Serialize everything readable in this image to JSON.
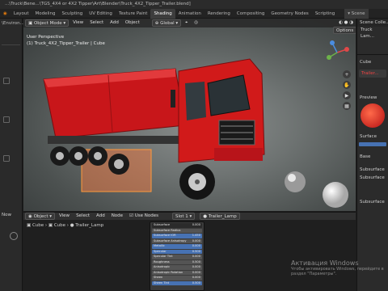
{
  "window": {
    "title": "...\\Truck\\Bene...\\TGS_4X4 or 4X2 Tipper\\Art\\Blender\\Truck_4X2_Tipper_Trailer.blend]"
  },
  "menu": [
    "Layout",
    "Modeling",
    "Sculpting",
    "UV Editing",
    "Texture Paint",
    "Shading",
    "Animation",
    "Rendering",
    "Compositing",
    "Geometry Nodes",
    "Scripting"
  ],
  "active_tab": "Shading",
  "scene": {
    "label": "Scene"
  },
  "left": {
    "top_label": "\\Environ...",
    "item_label": "Now"
  },
  "viewport": {
    "mode": "Object Mode",
    "menus": [
      "View",
      "Select",
      "Add",
      "Object"
    ],
    "orientation": "Global",
    "info_line1": "User Perspective",
    "info_line2": "(1) Truck_4X2_Tipper_Trailer | Cube",
    "options": "Options"
  },
  "outliner": {
    "title": "Scene Colle...",
    "items": [
      "Truck",
      "Lam..."
    ]
  },
  "properties": {
    "object": "Cube",
    "material": "Trailer...",
    "preview": "Preview",
    "surface": "Surface",
    "base": "Base",
    "rows": [
      "Subsurface",
      "Subsurface",
      "Subsurface"
    ]
  },
  "node_header": {
    "object_btn": "Object",
    "menus": [
      "View",
      "Select",
      "Add",
      "Node"
    ],
    "use_nodes": "Use Nodes",
    "slot": "Slot 1",
    "material": "Trailer_Lamp"
  },
  "breadcrumb": [
    "Cube",
    "Cube",
    "Trailer_Lamp"
  ],
  "node": {
    "props": [
      {
        "label": "Subsurface",
        "value": "0.000"
      },
      {
        "label": "Subsurface Radius",
        "value": ""
      },
      {
        "label": "Subsurface IOR",
        "value": "1.450"
      },
      {
        "label": "Subsurface Anisotropy",
        "value": "0.000"
      },
      {
        "label": "Metallic",
        "value": "0.000"
      },
      {
        "label": "Specular",
        "value": "0.500"
      },
      {
        "label": "Specular Tint",
        "value": "0.000"
      },
      {
        "label": "Roughness",
        "value": "0.500"
      },
      {
        "label": "Anisotropic",
        "value": "0.000"
      },
      {
        "label": "Anisotropic Rotation",
        "value": "0.000"
      },
      {
        "label": "Sheen",
        "value": "0.000"
      },
      {
        "label": "Sheen Tint",
        "value": "0.500"
      }
    ]
  },
  "watermark": {
    "line1": "Активация Windows",
    "line2": "Чтобы активировать Windows, перейдите в раздел \"Параметры\"."
  },
  "colors": {
    "accent": "#4772b3",
    "truck": "#d11a1a"
  }
}
